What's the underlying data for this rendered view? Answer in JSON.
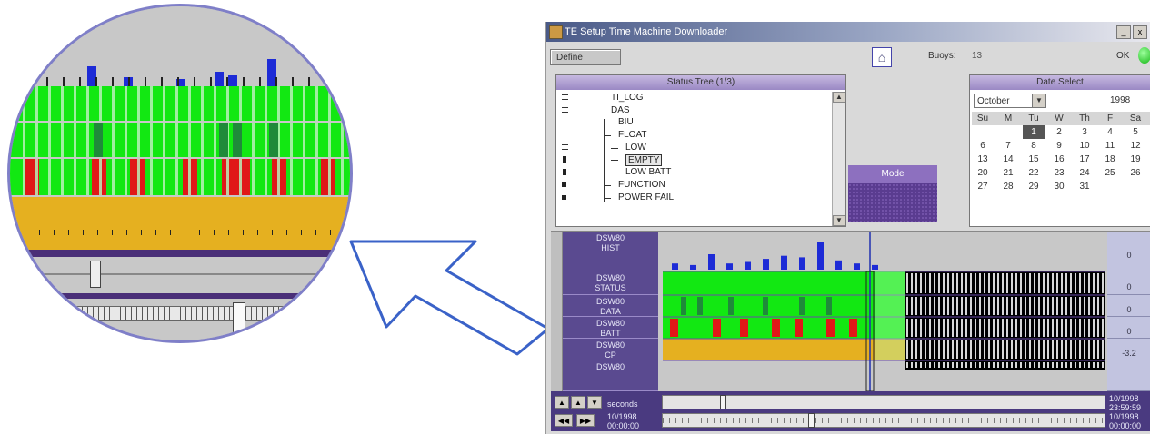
{
  "window": {
    "title": "TE Setup Time Machine Downloader",
    "define_button": "Define",
    "buoy_label": "Buoys:",
    "buoy_value": "13",
    "ok_label": "OK",
    "min_btn": "_",
    "close_btn": "x"
  },
  "tree": {
    "header": "Status Tree (1/3)",
    "items": [
      {
        "label": "TI_LOG",
        "indent": 0,
        "marker": "dash"
      },
      {
        "label": "DAS",
        "indent": 0,
        "marker": "dash"
      },
      {
        "label": "BIU",
        "indent": 1,
        "marker": "none"
      },
      {
        "label": "FLOAT",
        "indent": 1,
        "marker": "none"
      },
      {
        "label": "LOW",
        "indent": 2,
        "marker": "dash"
      },
      {
        "label": "EMPTY",
        "indent": 2,
        "marker": "bar",
        "selected": true
      },
      {
        "label": "LOW BATT",
        "indent": 2,
        "marker": "bar"
      },
      {
        "label": "FUNCTION",
        "indent": 1,
        "marker": "square"
      },
      {
        "label": "POWER FAIL",
        "indent": 1,
        "marker": "square"
      }
    ],
    "scroll_up": "▲",
    "scroll_down": "▼"
  },
  "mode": {
    "label": "Mode"
  },
  "calendar": {
    "header": "Date Select",
    "month": "October",
    "year": "1998",
    "weekdays": [
      "Su",
      "M",
      "Tu",
      "W",
      "Th",
      "F",
      "Sa"
    ],
    "weeks": [
      [
        "",
        "",
        "1",
        "2",
        "3",
        "4",
        "5"
      ],
      [
        "6",
        "7",
        "8",
        "9",
        "10",
        "11",
        "12"
      ],
      [
        "13",
        "14",
        "15",
        "16",
        "17",
        "18",
        "19"
      ],
      [
        "20",
        "21",
        "22",
        "23",
        "24",
        "25",
        "26"
      ],
      [
        "27",
        "28",
        "29",
        "30",
        "31",
        "",
        ""
      ]
    ],
    "selected": "1",
    "dropdown": "▼"
  },
  "timeline": {
    "rows": [
      {
        "label": "DSW80\nHIST",
        "value": "0"
      },
      {
        "label": "DSW80\nSTATUS",
        "value": "0"
      },
      {
        "label": "DSW80\nDATA",
        "value": "0"
      },
      {
        "label": "DSW80\nBATT",
        "value": "0"
      },
      {
        "label": "DSW80\nCP",
        "value": "-3.2"
      },
      {
        "label": "DSW80",
        "value": ""
      }
    ],
    "histogram": [
      4,
      3,
      10,
      4,
      5,
      7,
      9,
      8,
      18,
      6,
      4,
      3
    ],
    "controls": {
      "seconds_label": "seconds",
      "start_date": "10/1998\n00:00:00",
      "end_date": "10/1998\n23:59:59",
      "end_date2": "10/1998\n00:00:00",
      "btn_up": "▲",
      "btn_up2": "▲",
      "btn_down": "▼",
      "btn_rew": "◀◀",
      "btn_ff": "▶▶",
      "slider1_position": 0.13,
      "slider2_position": 0.33
    }
  },
  "colors": {
    "status_green": "#12e812",
    "alarm_red": "#e01818",
    "battery_yellow": "#e5b020",
    "histogram_blue": "#1d2bd6",
    "panel_purple": "#5a4a90",
    "arrow_blue": "#3a62c8"
  }
}
